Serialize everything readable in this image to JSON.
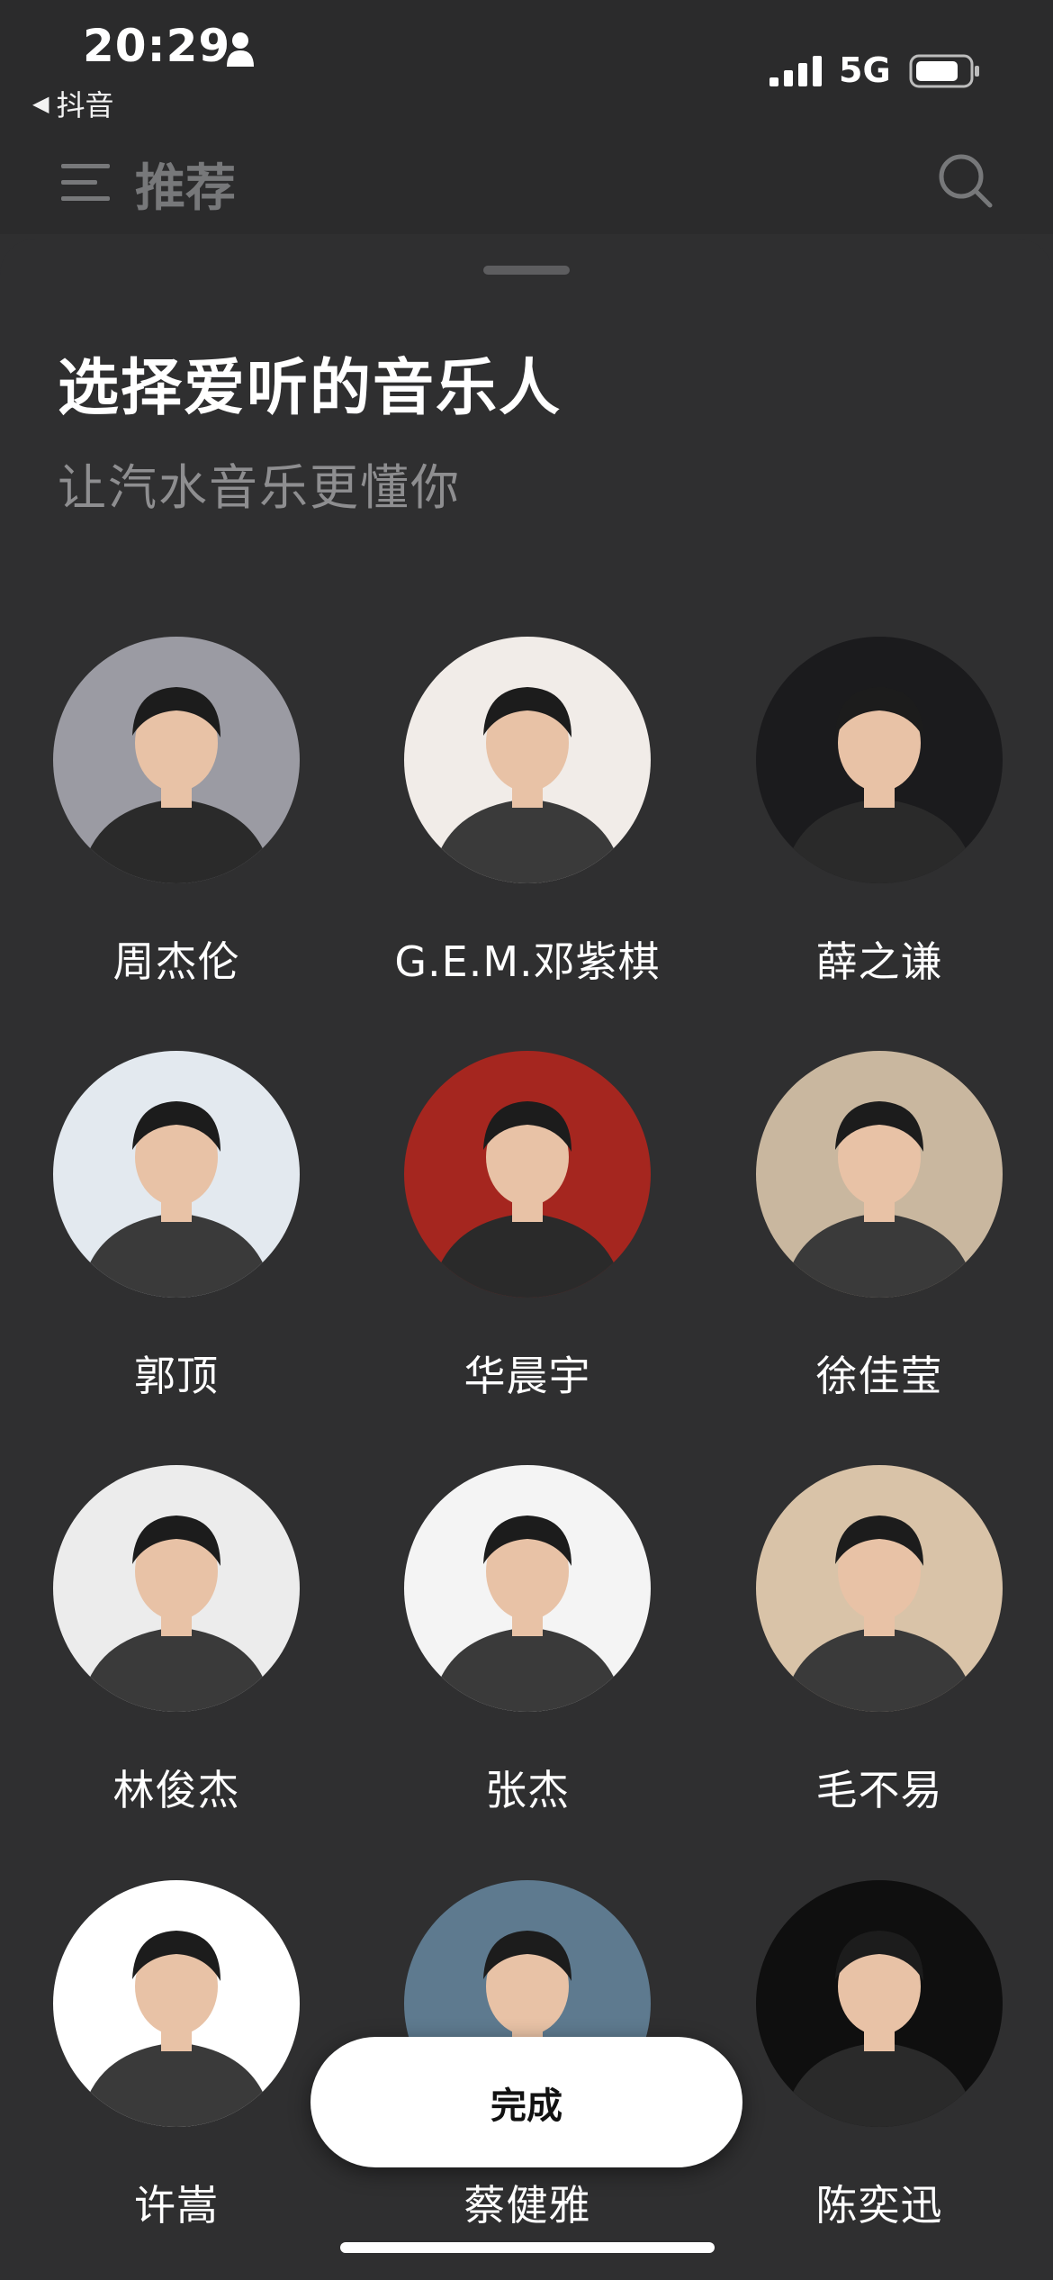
{
  "status_bar": {
    "time": "20:29",
    "back_app": "抖音",
    "network": "5G",
    "icons": [
      "person-icon",
      "signal-icon",
      "battery-icon"
    ]
  },
  "nav": {
    "title": "推荐",
    "menu_icon": "menu-icon",
    "search_icon": "search-icon"
  },
  "sheet": {
    "title": "选择爱听的音乐人",
    "subtitle": "让汽水音乐更懂你"
  },
  "artists": [
    {
      "name": "周杰伦",
      "bg": "#9b9ba3"
    },
    {
      "name": "G.E.M.邓紫棋",
      "bg": "#f1ece8"
    },
    {
      "name": "薛之谦",
      "bg": "#1b1b1d"
    },
    {
      "name": "郭顶",
      "bg": "#e3e9ef"
    },
    {
      "name": "华晨宇",
      "bg": "#a5261f"
    },
    {
      "name": "徐佳莹",
      "bg": "#c9b79f"
    },
    {
      "name": "林俊杰",
      "bg": "#ececec"
    },
    {
      "name": "张杰",
      "bg": "#f4f4f4"
    },
    {
      "name": "毛不易",
      "bg": "#d9c3a8"
    },
    {
      "name": "许嵩",
      "bg": "#ffffff"
    },
    {
      "name": "蔡健雅",
      "bg": "#5e7a8f"
    },
    {
      "name": "陈奕迅",
      "bg": "#0f0f0f"
    }
  ],
  "done_button": {
    "label": "完成"
  },
  "colors": {
    "background": "#2f2f30",
    "muted_text": "#8e8e90",
    "button_bg": "#ffffff"
  }
}
